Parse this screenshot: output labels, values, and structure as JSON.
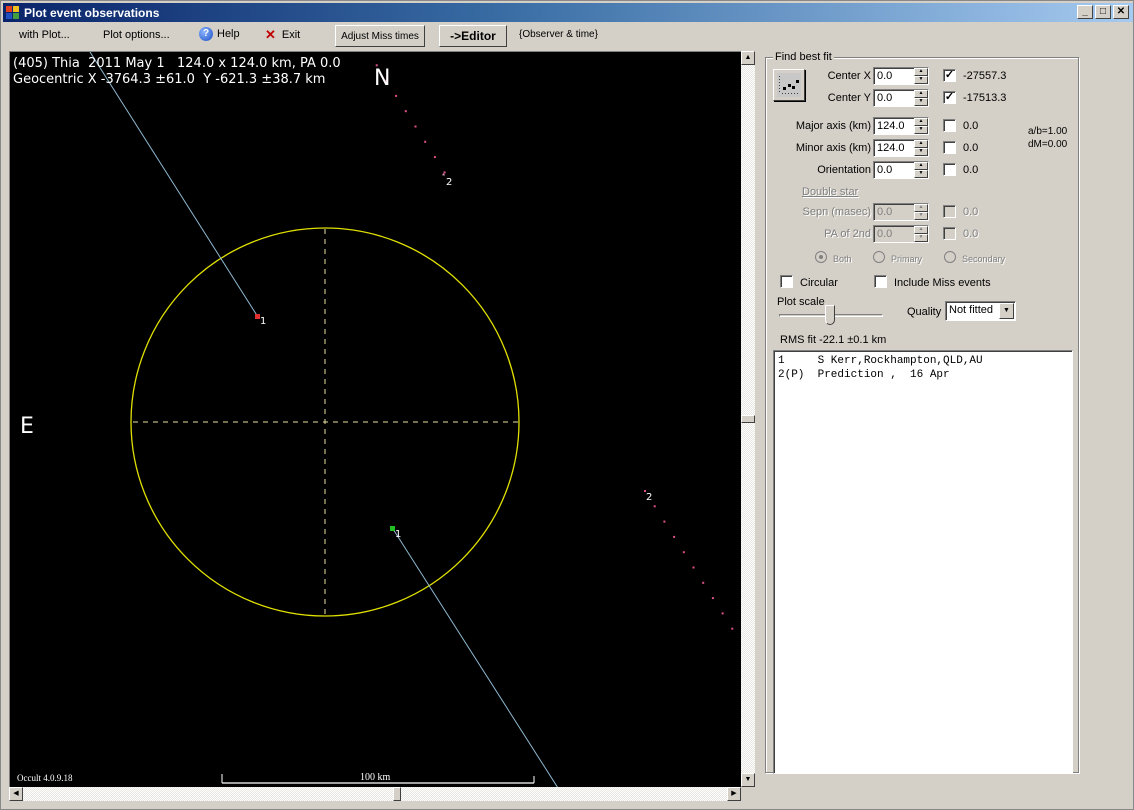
{
  "window": {
    "title": "Plot event observations",
    "controls": [
      "minimize",
      "maximize",
      "close"
    ]
  },
  "menubar": {
    "with_plot": "with Plot...",
    "plot_options": "Plot options...",
    "help": "Help",
    "exit": "Exit",
    "adjust_miss_times": "Adjust Miss times",
    "editor": "->Editor",
    "observer_time": "{Observer & time}"
  },
  "plot": {
    "header_line1": "(405) Thia  2011 May 1   124.0 x 124.0 km, PA 0.0",
    "header_line2": "Geocentric X -3764.3 ±61.0  Y -621.3 ±38.7 km",
    "north_label": "N",
    "east_label": "E",
    "version": "Occult 4.0.9.18",
    "scale_bar_label": "100 km",
    "chord_labels": [
      "1",
      "1",
      "2",
      "2"
    ],
    "colors": {
      "background": "#000000",
      "ellipse": "#e0e000",
      "axes": "#e8e0a0",
      "chord": "#8fb8d0",
      "prediction_dots": "#e0508a",
      "disappear_marker": "#e03030",
      "reappear_marker": "#20c020"
    }
  },
  "panel": {
    "group_title": "Find best fit",
    "fields": [
      {
        "label": "Center X",
        "value": "0.0",
        "checked": true,
        "result": "-27557.3",
        "enabled": true
      },
      {
        "label": "Center Y",
        "value": "0.0",
        "checked": true,
        "result": "-17513.3",
        "enabled": true
      },
      {
        "label": "Major axis (km)",
        "value": "124.0",
        "checked": false,
        "result": "0.0",
        "enabled": true
      },
      {
        "label": "Minor axis (km)",
        "value": "124.0",
        "checked": false,
        "result": "0.0",
        "enabled": true
      },
      {
        "label": "Orientation",
        "value": "0.0",
        "checked": false,
        "result": "0.0",
        "enabled": true
      }
    ],
    "ab_ratio": "a/b=1.00",
    "dm": "dM=0.00",
    "double_star": {
      "title": "Double star",
      "fields": [
        {
          "label": "Sepn (masec)",
          "value": "0.0",
          "checked": false,
          "result": "0.0"
        },
        {
          "label": "PA of 2nd",
          "value": "0.0",
          "checked": false,
          "result": "0.0"
        }
      ],
      "radios": [
        {
          "label": "Both",
          "selected": true
        },
        {
          "label": "Primary",
          "selected": false
        },
        {
          "label": "Secondary",
          "selected": false
        }
      ]
    },
    "circular": {
      "label": "Circular",
      "checked": false
    },
    "include_miss": {
      "label": "Include Miss events",
      "checked": false
    },
    "plot_scale_label": "Plot scale",
    "plot_scale_value": 0.45,
    "quality_label": "Quality",
    "quality_value": "Not fitted",
    "rms_fit": "RMS fit -22.1 ±0.1 km",
    "observers": [
      "1     S Kerr,Rockhampton,QLD,AU",
      "2(P)  Prediction ,  16 Apr"
    ]
  }
}
